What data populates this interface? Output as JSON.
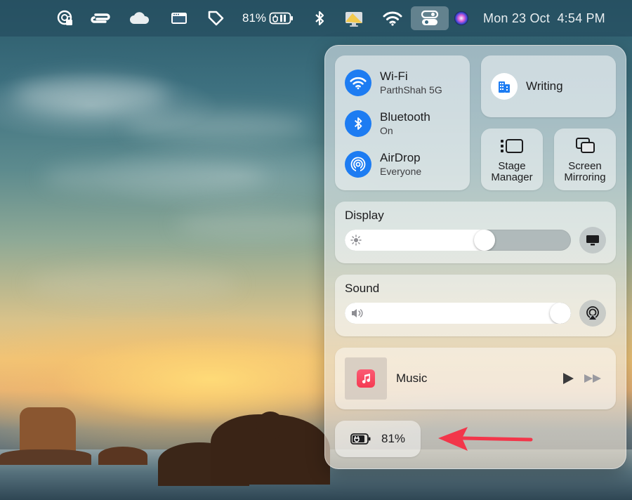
{
  "menubar": {
    "battery_percent": "81%",
    "datetime": "Mon 23 Oct  4:54 PM",
    "icons": [
      "sync-lock-icon",
      "dual-arrows-icon",
      "cloud-icon",
      "window-icon",
      "tag-icon",
      "battery-charging-icon",
      "bluetooth-icon",
      "screen-share-icon",
      "wifi-icon",
      "control-center-icon",
      "siri-icon"
    ]
  },
  "control_center": {
    "wifi": {
      "title": "Wi-Fi",
      "subtitle": "ParthShah 5G",
      "on": true
    },
    "bluetooth": {
      "title": "Bluetooth",
      "subtitle": "On",
      "on": true
    },
    "airdrop": {
      "title": "AirDrop",
      "subtitle": "Everyone",
      "on": true
    },
    "focus": {
      "label": "Writing"
    },
    "stage_manager": {
      "label_line1": "Stage",
      "label_line2": "Manager"
    },
    "screen_mirroring": {
      "label_line1": "Screen",
      "label_line2": "Mirroring"
    },
    "display": {
      "title": "Display",
      "brightness": 0.63
    },
    "sound": {
      "title": "Sound",
      "volume": 1.0
    },
    "music": {
      "app": "Music"
    },
    "battery": {
      "percent": "81%"
    }
  },
  "colors": {
    "accent": "#1d7cf2",
    "annotation_arrow": "#f2364a"
  }
}
